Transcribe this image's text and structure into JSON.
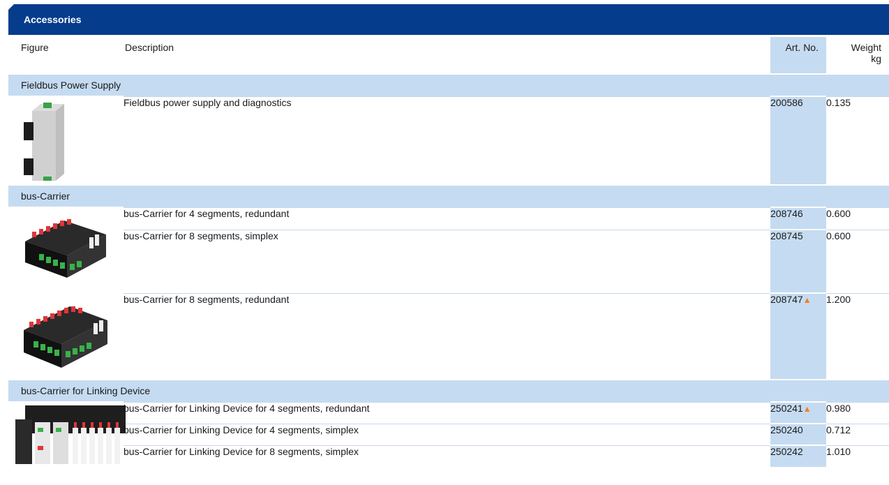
{
  "title": "Accessories",
  "columns": {
    "figure": "Figure",
    "description": "Description",
    "art_no": "Art. No.",
    "weight_line1": "Weight",
    "weight_line2": "kg"
  },
  "groups": [
    {
      "name": "Fieldbus Power Supply",
      "rows": [
        {
          "description": "Fieldbus power supply and diagnostics",
          "art_no": "200586",
          "weight": "0.135"
        }
      ]
    },
    {
      "name": "bus-Carrier",
      "rows": [
        {
          "description": "bus-Carrier for 4 segments, redundant",
          "art_no": "208746",
          "weight": "0.600"
        },
        {
          "description": "bus-Carrier for 8 segments, simplex",
          "art_no": "208745",
          "weight": "0.600"
        },
        {
          "description": "bus-Carrier for 8 segments, redundant",
          "art_no": "208747",
          "marker": "▲",
          "weight": "1.200"
        }
      ]
    },
    {
      "name": "bus-Carrier for Linking Device",
      "rows": [
        {
          "description": "bus-Carrier for Linking Device for 4 segments, redundant",
          "art_no": "250241",
          "marker": "▲",
          "weight": "0.980"
        },
        {
          "description": "bus-Carrier for Linking Device for 4 segments, simplex",
          "art_no": "250240",
          "weight": "0.712"
        },
        {
          "description": "bus-Carrier for Linking Device for 8 segments, simplex",
          "art_no": "250242",
          "weight": "1.010"
        }
      ]
    }
  ],
  "colors": {
    "header_bg": "#063c8c",
    "band_bg": "#c5dbf1",
    "marker": "#f08018"
  },
  "icons": [
    "power-supply-module-image",
    "bus-carrier-image",
    "linking-device-carrier-image"
  ]
}
